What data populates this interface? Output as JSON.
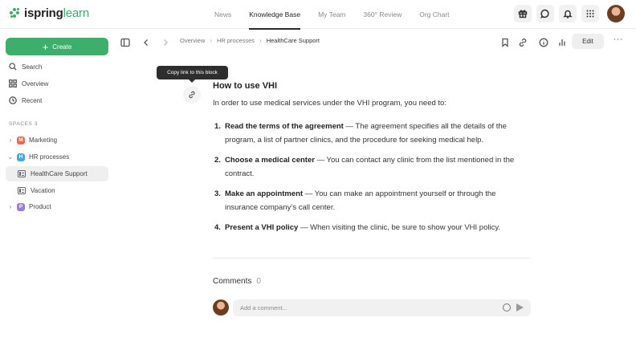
{
  "app": {
    "logo_text_bold": "ispring",
    "logo_text_light": "learn",
    "brand_color": "#3dae6c"
  },
  "topnav": {
    "items": [
      {
        "label": "News",
        "active": false
      },
      {
        "label": "Knowledge Base",
        "active": true
      },
      {
        "label": "My Team",
        "active": false
      },
      {
        "label": "360° Review",
        "active": false
      },
      {
        "label": "Org Chart",
        "active": false
      }
    ],
    "icons": [
      "gift-icon",
      "chat-icon",
      "bell-icon",
      "apps-grid-icon",
      "user-avatar"
    ]
  },
  "sidebar": {
    "create_label": "Create",
    "links": [
      {
        "label": "Search",
        "icon": "search-icon"
      },
      {
        "label": "Overview",
        "icon": "overview-icon"
      },
      {
        "label": "Recent",
        "icon": "clock-icon"
      }
    ],
    "spaces_label": "SPACES 3",
    "spaces": [
      {
        "label": "Marketing",
        "badge": "M",
        "badge_color": "#f06a4a",
        "expanded": false
      },
      {
        "label": "HR processes",
        "badge": "H",
        "badge_color": "#4aa8d8",
        "expanded": true,
        "children": [
          {
            "label": "HealthCare Support",
            "selected": true
          },
          {
            "label": "Vacation",
            "selected": false
          }
        ]
      },
      {
        "label": "Product",
        "badge": "P",
        "badge_color": "#9b7be0",
        "expanded": false
      }
    ]
  },
  "toolbar": {
    "breadcrumbs": [
      "Overview",
      "HR processes",
      "HealthCare Support"
    ],
    "edit_label": "Edit",
    "more_label": "···"
  },
  "tooltip": {
    "text": "Copy link to this block"
  },
  "article": {
    "heading": "How to use VHI",
    "intro": "In order to use medical services under the VHI program, you need to:",
    "steps": [
      {
        "num": "1.",
        "title": "Read the terms of the agreement",
        "text": " — The agreement specifies all the details of the program, a list of partner clinics, and the procedure for seeking medical help."
      },
      {
        "num": "2.",
        "title": "Choose a medical center",
        "text": " — You can contact any clinic from the list mentioned in the contract."
      },
      {
        "num": "3.",
        "title": "Make an appointment",
        "text": " — You can make an appointment yourself or through the insurance company’s call center."
      },
      {
        "num": "4.",
        "title": "Present a VHI policy",
        "text": " — When visiting the clinic, be sure to show your VHI policy."
      }
    ]
  },
  "comments": {
    "label": "Comments",
    "count": "0",
    "placeholder": "Add a comment..."
  }
}
